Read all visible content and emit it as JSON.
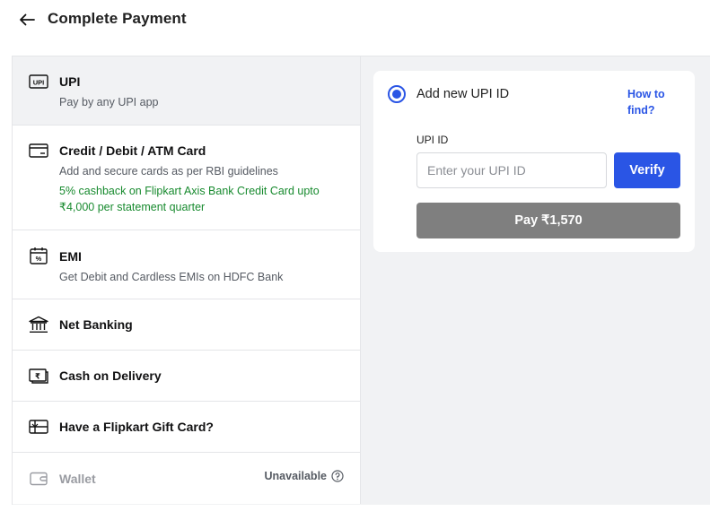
{
  "header": {
    "title": "Complete Payment",
    "back_icon": "arrow-left-icon"
  },
  "methods": [
    {
      "id": "upi",
      "icon": "upi-icon",
      "title": "UPI",
      "subtitle": "Pay by any UPI app",
      "active": true
    },
    {
      "id": "card",
      "icon": "credit-card-icon",
      "title": "Credit / Debit / ATM Card",
      "subtitle": "Add and secure cards as per RBI guidelines",
      "offer": "5% cashback on Flipkart Axis Bank Credit Card upto ₹4,000 per statement quarter"
    },
    {
      "id": "emi",
      "icon": "emi-calendar-icon",
      "title": "EMI",
      "subtitle": "Get Debit and Cardless EMIs on HDFC Bank"
    },
    {
      "id": "netbanking",
      "icon": "bank-icon",
      "title": "Net Banking"
    },
    {
      "id": "cod",
      "icon": "cash-icon",
      "title": "Cash on Delivery"
    },
    {
      "id": "giftcard",
      "icon": "gift-card-icon",
      "title": "Have a Flipkart Gift Card?"
    },
    {
      "id": "wallet",
      "icon": "wallet-icon",
      "title": "Wallet",
      "status": "Unavailable",
      "disabled": true
    }
  ],
  "upi_form": {
    "option_label": "Add new UPI ID",
    "how_to_find": "How to find?",
    "field_label": "UPI ID",
    "placeholder": "Enter your UPI ID",
    "value": "",
    "verify_label": "Verify",
    "pay_label": "Pay ₹1,570"
  },
  "colors": {
    "accent": "#2a55e5",
    "offer_green": "#178a2e",
    "pay_disabled": "#7f7f7f",
    "panel_bg": "#f1f2f4"
  }
}
